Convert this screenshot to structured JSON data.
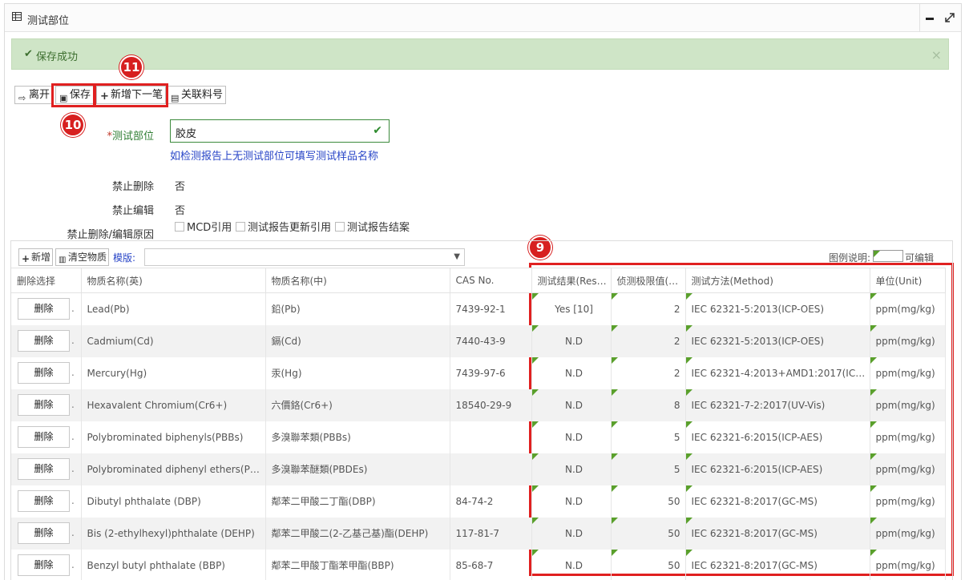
{
  "panel": {
    "title": "测试部位"
  },
  "alert": {
    "message": "保存成功",
    "close": "×"
  },
  "toolbar": {
    "leave": "离开",
    "save": "保存",
    "add_next": "新增下一笔",
    "link_material": "关联料号"
  },
  "badges": {
    "b9": "9",
    "b10": "10",
    "b11": "11"
  },
  "form": {
    "part_label": "测试部位",
    "part_required": "*",
    "part_value": "胶皮",
    "hint": "如检测报告上无测试部位可填写测试样品名称",
    "no_delete_label": "禁止删除",
    "no_delete_value": "否",
    "no_edit_label": "禁止编辑",
    "no_edit_value": "否",
    "reason_label": "禁止删除/编辑原因",
    "reasons": [
      "MCD引用",
      "测试报告更新引用",
      "测试报告结案"
    ]
  },
  "grid_toolbar": {
    "add": "新增",
    "clear": "清空物质",
    "template_label": "模版:",
    "template_value": "",
    "legend_label": "图例说明:",
    "legend_text": "可编辑"
  },
  "table": {
    "columns": [
      "删除选择",
      "物质名称(英)",
      "物质名称(中)",
      "CAS No.",
      "测试结果(Res…",
      "侦测极限值(…",
      "测试方法(Method)",
      "单位(Unit)"
    ],
    "delete_label": "删除",
    "rows": [
      {
        "en": "Lead(Pb)",
        "cn": "鉛(Pb)",
        "cas": "7439-92-1",
        "result": "Yes [10]",
        "limit": "2",
        "method": "IEC 62321-5:2013(ICP-OES)",
        "unit": "ppm(mg/kg)"
      },
      {
        "en": "Cadmium(Cd)",
        "cn": "鎘(Cd)",
        "cas": "7440-43-9",
        "result": "N.D",
        "limit": "2",
        "method": "IEC 62321-5:2013(ICP-OES)",
        "unit": "ppm(mg/kg)"
      },
      {
        "en": "Mercury(Hg)",
        "cn": "汞(Hg)",
        "cas": "7439-97-6",
        "result": "N.D",
        "limit": "2",
        "method": "IEC 62321-4:2013+AMD1:2017(ICP-…",
        "unit": "ppm(mg/kg)"
      },
      {
        "en": "Hexavalent Chromium(Cr6+)",
        "cn": "六價鉻(Cr6+)",
        "cas": "18540-29-9",
        "result": "N.D",
        "limit": "8",
        "method": "IEC 62321-7-2:2017(UV-Vis)",
        "unit": "ppm(mg/kg)"
      },
      {
        "en": "Polybrominated biphenyls(PBBs)",
        "cn": "多溴聯苯類(PBBs)",
        "cas": "",
        "result": "N.D",
        "limit": "5",
        "method": "IEC 62321-6:2015(ICP-AES)",
        "unit": "ppm(mg/kg)"
      },
      {
        "en": "Polybrominated diphenyl ethers(PBDEs)",
        "cn": "多溴聯苯醚類(PBDEs)",
        "cas": "",
        "result": "N.D",
        "limit": "5",
        "method": "IEC 62321-6:2015(ICP-AES)",
        "unit": "ppm(mg/kg)"
      },
      {
        "en": "Dibutyl phthalate (DBP)",
        "cn": "鄰苯二甲酸二丁酯(DBP)",
        "cas": "84-74-2",
        "result": "N.D",
        "limit": "50",
        "method": "IEC 62321-8:2017(GC-MS)",
        "unit": "ppm(mg/kg)"
      },
      {
        "en": "Bis (2-ethylhexyl)phthalate (DEHP)",
        "cn": "鄰苯二甲酸二(2-乙基己基)酯(DEHP)",
        "cas": "117-81-7",
        "result": "N.D",
        "limit": "50",
        "method": "IEC 62321-8:2017(GC-MS)",
        "unit": "ppm(mg/kg)"
      },
      {
        "en": "Benzyl butyl phthalate (BBP)",
        "cn": "鄰苯二甲酸丁酯苯甲酯(BBP)",
        "cas": "85-68-7",
        "result": "N.D",
        "limit": "50",
        "method": "IEC 62321-8:2017(GC-MS)",
        "unit": "ppm(mg/kg)"
      }
    ]
  },
  "colors": {
    "alert_bg": "#cfe5c7",
    "highlight": "#e02020",
    "editable_marker": "#5aa02c",
    "link_blue": "#2845c7"
  }
}
